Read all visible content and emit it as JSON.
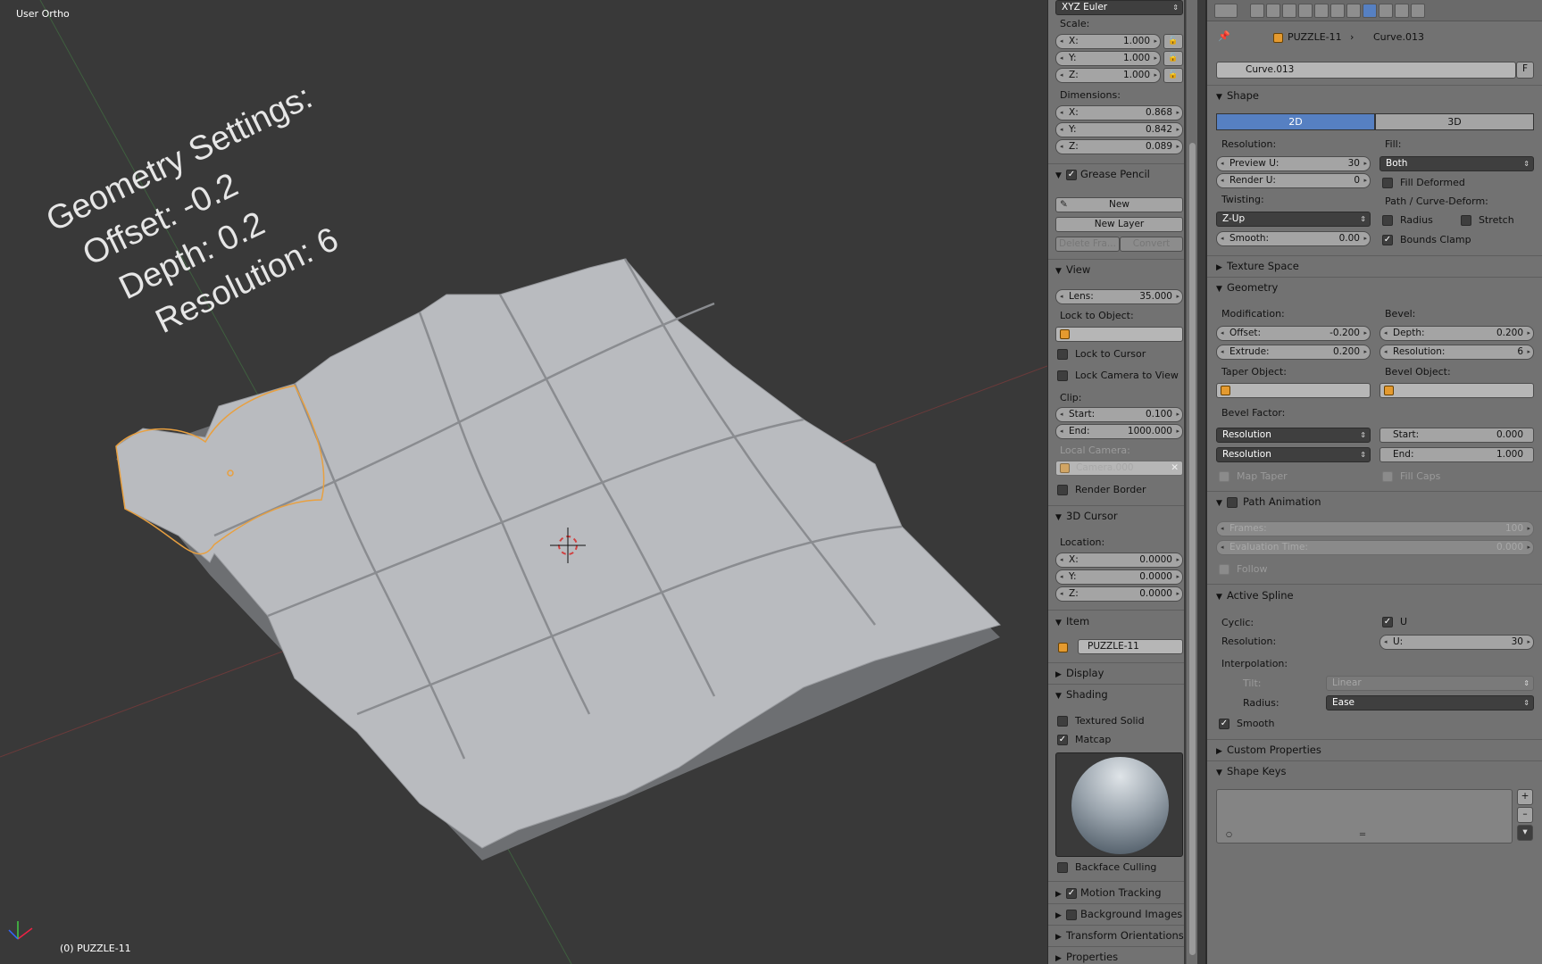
{
  "viewport": {
    "view_label": "User Ortho",
    "status": "(0) PUZZLE-11",
    "overlay_text": [
      "Geometry Settings:",
      "Offset: -0.2",
      "Depth: 0.2",
      "Resolution: 6"
    ]
  },
  "npanel": {
    "rotation_mode": "XYZ Euler",
    "scale_label": "Scale:",
    "scale": [
      {
        "k": "X:",
        "v": "1.000"
      },
      {
        "k": "Y:",
        "v": "1.000"
      },
      {
        "k": "Z:",
        "v": "1.000"
      }
    ],
    "dimensions_label": "Dimensions:",
    "dimensions": [
      {
        "k": "X:",
        "v": "0.868"
      },
      {
        "k": "Y:",
        "v": "0.842"
      },
      {
        "k": "Z:",
        "v": "0.089"
      }
    ],
    "grease_pencil": {
      "title": "Grease Pencil",
      "new": "New",
      "new_layer": "New Layer",
      "delete_frame": "Delete Fra...",
      "convert": "Convert"
    },
    "view": {
      "title": "View",
      "lens_k": "Lens:",
      "lens_v": "35.000",
      "lock_to_object": "Lock to Object:",
      "lock_to_cursor": "Lock to Cursor",
      "lock_camera": "Lock Camera to View",
      "clip": "Clip:",
      "start_k": "Start:",
      "start_v": "0.100",
      "end_k": "End:",
      "end_v": "1000.000",
      "local_camera": "Local Camera:",
      "camera": "Camera.000",
      "render_border": "Render Border"
    },
    "cursor": {
      "title": "3D Cursor",
      "location": "Location:",
      "items": [
        {
          "k": "X:",
          "v": "0.0000"
        },
        {
          "k": "Y:",
          "v": "0.0000"
        },
        {
          "k": "Z:",
          "v": "0.0000"
        }
      ]
    },
    "item": {
      "title": "Item",
      "name": "PUZZLE-11"
    },
    "display_title": "Display",
    "shading": {
      "title": "Shading",
      "textured_solid": "Textured Solid",
      "matcap": "Matcap",
      "backface_culling": "Backface Culling"
    },
    "motion_tracking": "Motion Tracking",
    "background_images": "Background Images",
    "transform_orientations": "Transform Orientations",
    "properties": "Properties"
  },
  "props": {
    "breadcrumb": {
      "object": "PUZZLE-11",
      "data": "Curve.013"
    },
    "datablock": {
      "name": "Curve.013",
      "fake": "F"
    },
    "shape": {
      "title": "Shape",
      "tab_2d": "2D",
      "tab_3d": "3D",
      "resolution": "Resolution:",
      "preview_k": "Preview U:",
      "preview_v": "30",
      "render_k": "Render U:",
      "render_v": "0",
      "fill": "Fill:",
      "fill_value": "Both",
      "fill_deformed": "Fill Deformed",
      "twisting": "Twisting:",
      "twist_value": "Z-Up",
      "smooth_k": "Smooth:",
      "smooth_v": "0.00",
      "path_deform": "Path / Curve-Deform:",
      "radius": "Radius",
      "stretch": "Stretch",
      "bounds_clamp": "Bounds Clamp"
    },
    "texture_space": "Texture Space",
    "geometry": {
      "title": "Geometry",
      "modification": "Modification:",
      "offset_k": "Offset:",
      "offset_v": "-0.200",
      "extrude_k": "Extrude:",
      "extrude_v": "0.200",
      "bevel": "Bevel:",
      "depth_k": "Depth:",
      "depth_v": "0.200",
      "res_k": "Resolution:",
      "res_v": "6",
      "taper_object": "Taper Object:",
      "bevel_object": "Bevel Object:",
      "bevel_factor": "Bevel Factor:",
      "mode1": "Resolution",
      "mode2": "Resolution",
      "start_k": "Start:",
      "start_v": "0.000",
      "end_k": "End:",
      "end_v": "1.000",
      "map_taper": "Map Taper",
      "fill_caps": "Fill Caps"
    },
    "path_animation": {
      "title": "Path Animation",
      "frames_k": "Frames:",
      "frames_v": "100",
      "eval_k": "Evaluation Time:",
      "eval_v": "0.000",
      "follow": "Follow"
    },
    "active_spline": {
      "title": "Active Spline",
      "cyclic": "Cyclic:",
      "u": "U",
      "resolution": "Resolution:",
      "u_k": "U:",
      "u_v": "30",
      "interpolation": "Interpolation:",
      "tilt": "Tilt:",
      "tilt_v": "Linear",
      "radius": "Radius:",
      "radius_v": "Ease",
      "smooth": "Smooth"
    },
    "custom_properties": "Custom Properties",
    "shape_keys": "Shape Keys"
  }
}
